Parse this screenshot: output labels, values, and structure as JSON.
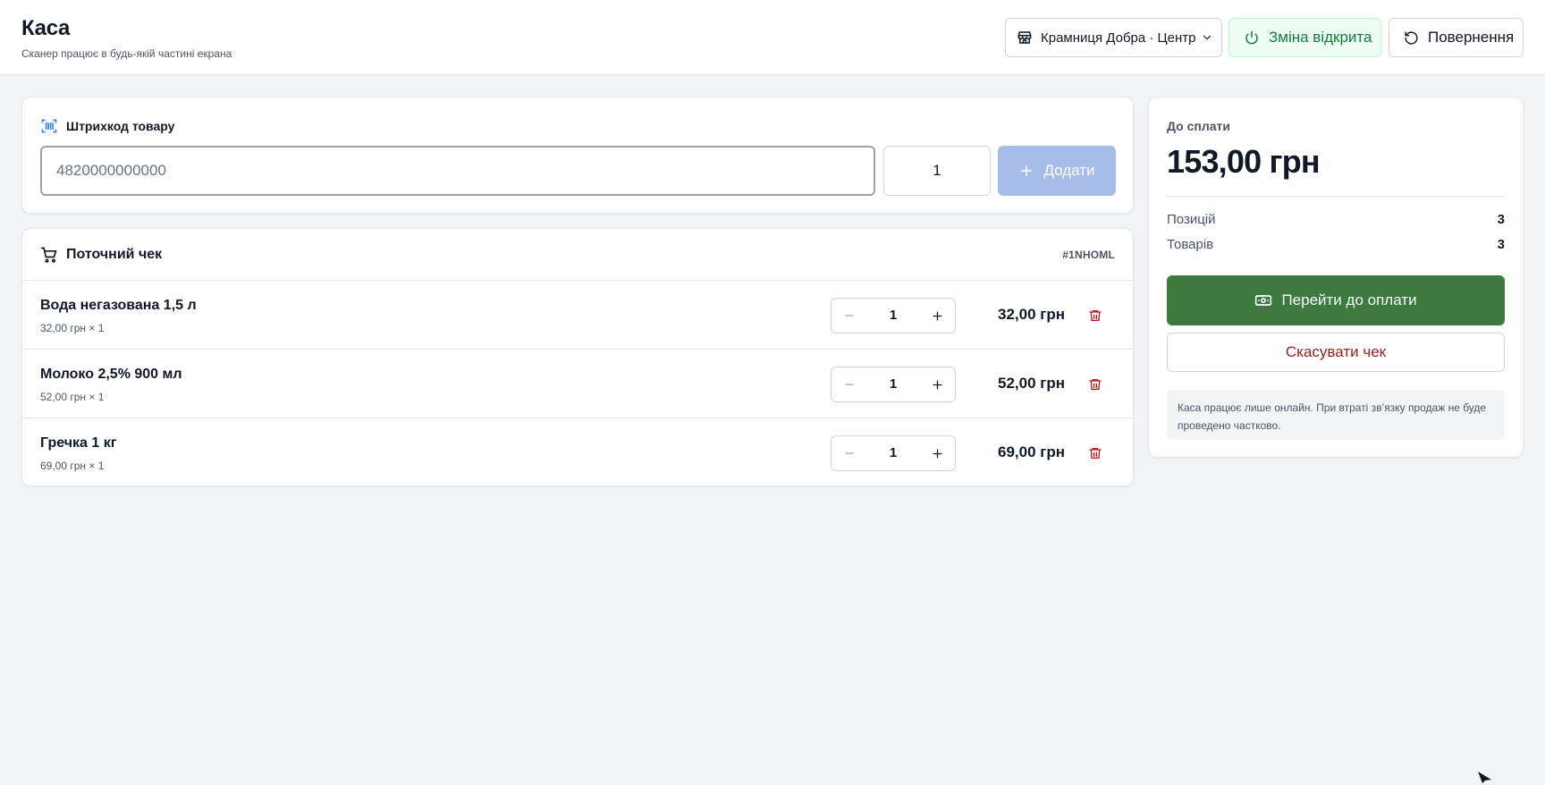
{
  "header": {
    "title": "Каса",
    "subtitle": "Сканер працює в будь-якій частині екрана",
    "store_label": "Крамниця Добра · Центр",
    "store_icon": "store-icon",
    "shift_label": "Зміна відкрита",
    "shift_icon": "power-icon",
    "return_label": "Повернення",
    "return_icon": "rotate-ccw-icon"
  },
  "scanner": {
    "title": "Штрихкод товару",
    "icon": "barcode-scan-icon",
    "barcode_placeholder": "4820000000000",
    "barcode_value": "",
    "quantity_value": "1",
    "add_label": "Додати",
    "add_icon": "plus-icon"
  },
  "receipt": {
    "title": "Поточний чек",
    "icon": "shopping-cart-icon",
    "id": "#1NHOML",
    "items": [
      {
        "name": "Вода негазована 1,5 л",
        "unit_line": "32,00 грн × 1",
        "qty": "1",
        "total": "32,00 грн"
      },
      {
        "name": "Молоко 2,5% 900 мл",
        "unit_line": "52,00 грн × 1",
        "qty": "1",
        "total": "52,00 грн"
      },
      {
        "name": "Гречка 1 кг",
        "unit_line": "69,00 грн × 1",
        "qty": "1",
        "total": "69,00 грн"
      }
    ]
  },
  "summary": {
    "due_label": "До сплати",
    "due_amount": "153,00 грн",
    "positions_label": "Позицій",
    "positions_value": "3",
    "goods_label": "Товарів",
    "goods_value": "3",
    "pay_label": "Перейти до оплати",
    "pay_icon": "banknote-icon",
    "cancel_label": "Скасувати чек",
    "notice": "Каса працює лише онлайн. При втраті зв’язку продаж не буде проведено частково."
  },
  "colors": {
    "page_bg": "#f3f4f6",
    "primary_green": "#3c7a3f",
    "shift_bg": "#ecfdf3",
    "shift_text": "#15803d",
    "add_disabled": "#a6bdea",
    "danger": "#9b1c1c",
    "accent_blue": "#3b82f6"
  }
}
